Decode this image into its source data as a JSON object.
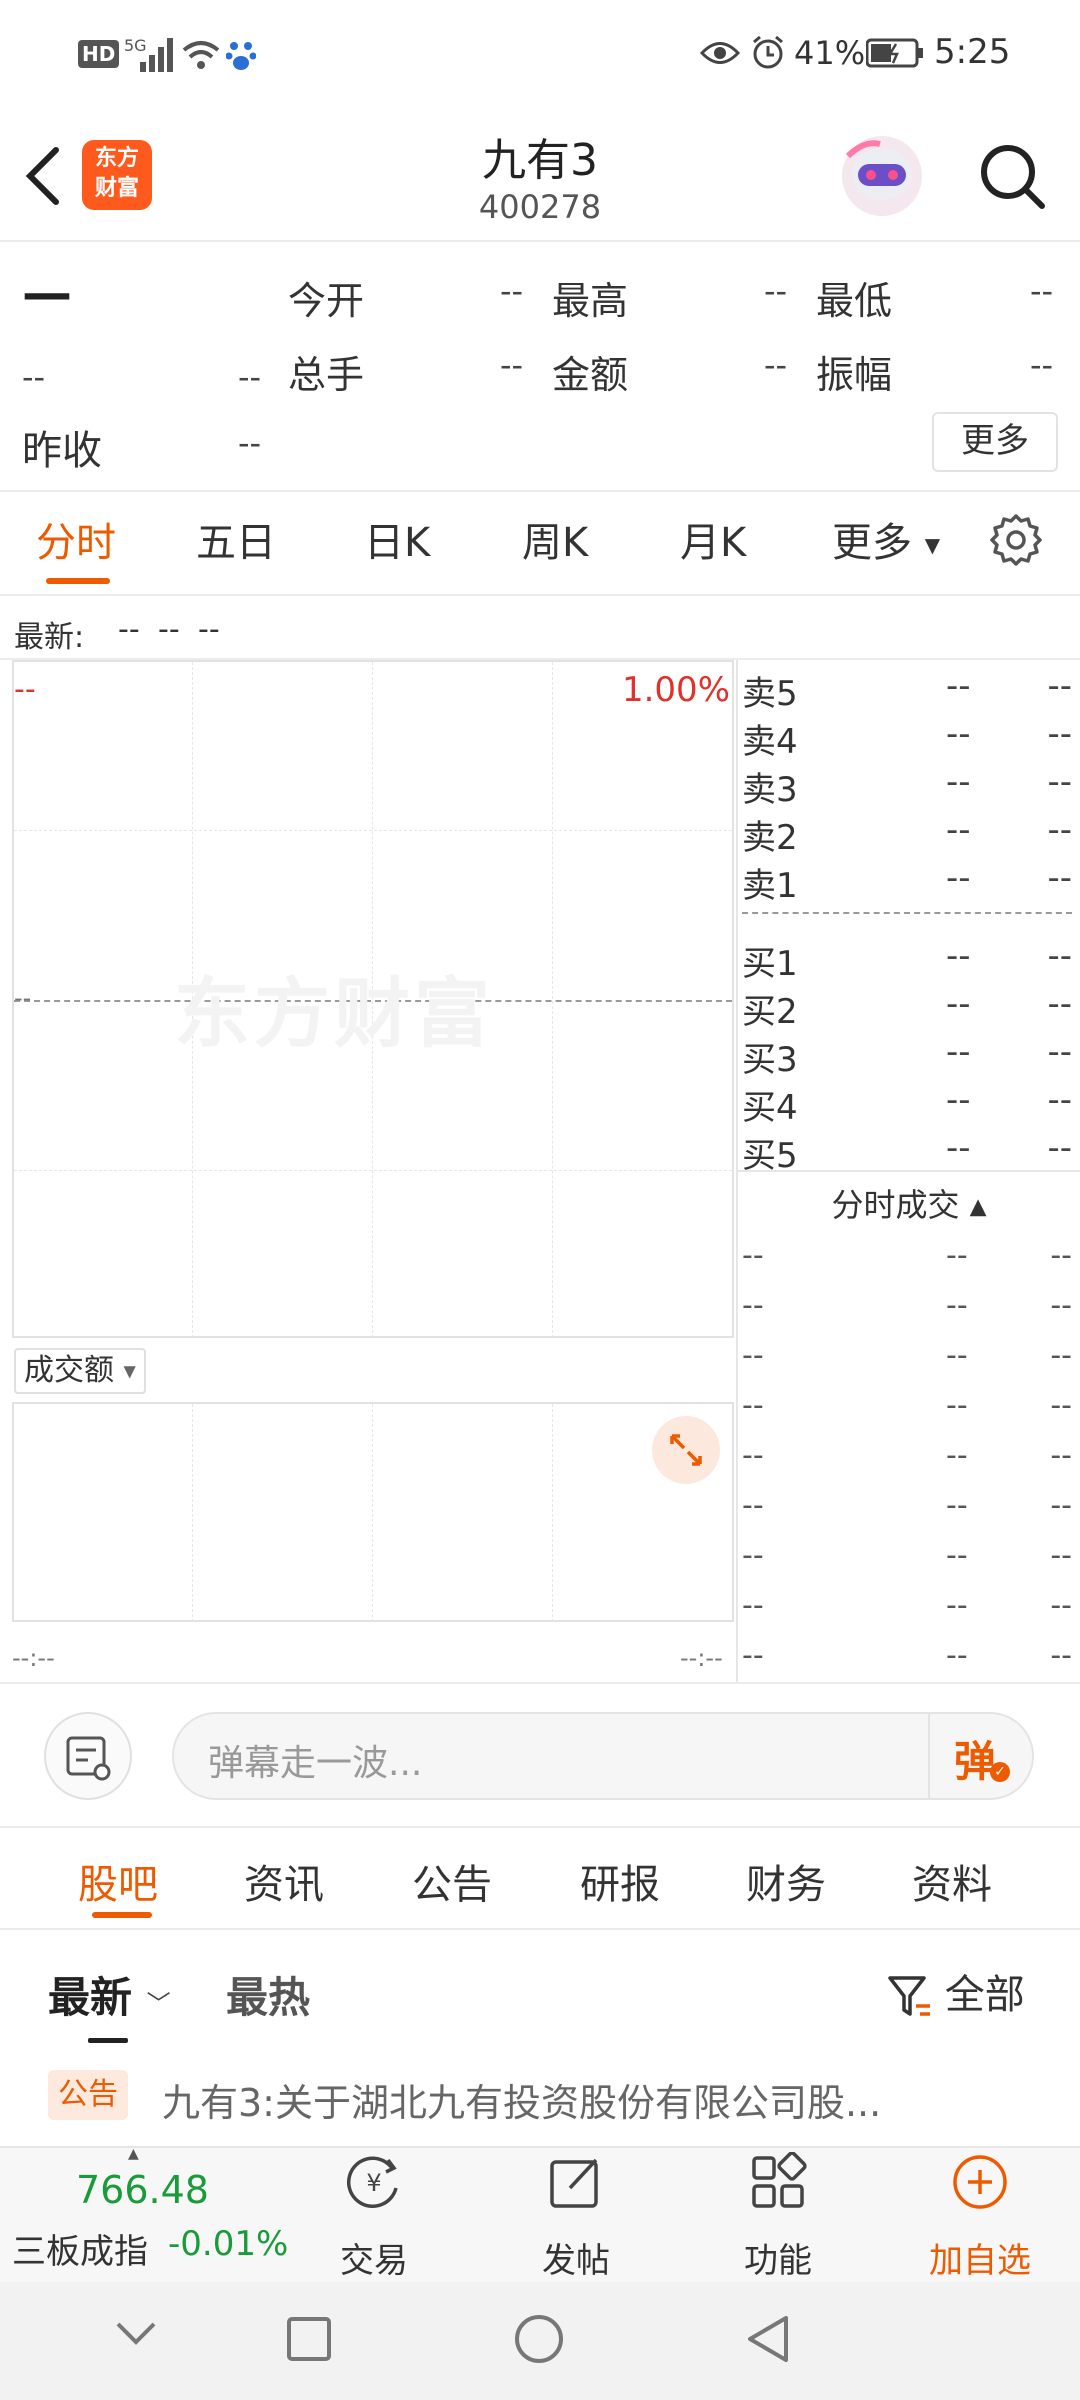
{
  "status_bar": {
    "network_badge": "HD",
    "network_type": "5G",
    "battery_text": "41%",
    "time": "5:25"
  },
  "header": {
    "logo_text": "东方\n财富",
    "title": "九有3",
    "code": "400278"
  },
  "quote": {
    "price": "—",
    "change": "--",
    "change_pct": "--",
    "stats": [
      {
        "label": "今开",
        "value": "--"
      },
      {
        "label": "最高",
        "value": "--"
      },
      {
        "label": "最低",
        "value": "--"
      },
      {
        "label": "总手",
        "value": "--"
      },
      {
        "label": "金额",
        "value": "--"
      },
      {
        "label": "振幅",
        "value": "--"
      }
    ],
    "prev_close_label": "昨收",
    "prev_close_value": "--",
    "more_button": "更多"
  },
  "chart_tabs": [
    "分时",
    "五日",
    "日K",
    "周K",
    "月K",
    "更多"
  ],
  "latest_bar": {
    "label": "最新:",
    "v1": "--",
    "v2": "--",
    "v3": "--"
  },
  "chart": {
    "left_top": "--",
    "right_top": "1.00%",
    "mid_left": "--",
    "watermark": "东方财富",
    "volume_selector": "成交额",
    "time_left": "--:--",
    "time_right": "--:--"
  },
  "order_book": {
    "sell": [
      {
        "label": "卖5",
        "price": "--",
        "vol": "--"
      },
      {
        "label": "卖4",
        "price": "--",
        "vol": "--"
      },
      {
        "label": "卖3",
        "price": "--",
        "vol": "--"
      },
      {
        "label": "卖2",
        "price": "--",
        "vol": "--"
      },
      {
        "label": "卖1",
        "price": "--",
        "vol": "--"
      }
    ],
    "buy": [
      {
        "label": "买1",
        "price": "--",
        "vol": "--"
      },
      {
        "label": "买2",
        "price": "--",
        "vol": "--"
      },
      {
        "label": "买3",
        "price": "--",
        "vol": "--"
      },
      {
        "label": "买4",
        "price": "--",
        "vol": "--"
      },
      {
        "label": "买5",
        "price": "--",
        "vol": "--"
      }
    ],
    "trades_title": "分时成交",
    "trades": [
      {
        "time": "--",
        "price": "--",
        "vol": "--"
      },
      {
        "time": "--",
        "price": "--",
        "vol": "--"
      },
      {
        "time": "--",
        "price": "--",
        "vol": "--"
      },
      {
        "time": "--",
        "price": "--",
        "vol": "--"
      },
      {
        "time": "--",
        "price": "--",
        "vol": "--"
      },
      {
        "time": "--",
        "price": "--",
        "vol": "--"
      },
      {
        "time": "--",
        "price": "--",
        "vol": "--"
      },
      {
        "time": "--",
        "price": "--",
        "vol": "--"
      },
      {
        "time": "--",
        "price": "--",
        "vol": "--"
      }
    ]
  },
  "danmaku": {
    "placeholder": "弹幕走一波...",
    "send_label": "弹"
  },
  "news_tabs": [
    "股吧",
    "资讯",
    "公告",
    "研报",
    "财务",
    "资料"
  ],
  "filters": {
    "latest": "最新",
    "hottest": "最热",
    "all": "全部"
  },
  "post": {
    "badge": "公告",
    "title": "九有3:关于湖北九有投资股份有限公司股..."
  },
  "bottom_nav": {
    "index_value": "766.48",
    "index_name": "三板成指",
    "index_change": "-0.01%",
    "items": [
      {
        "label": "交易",
        "icon": "trade-icon"
      },
      {
        "label": "发帖",
        "icon": "post-icon"
      },
      {
        "label": "功能",
        "icon": "apps-icon"
      },
      {
        "label": "加自选",
        "icon": "add-watchlist-icon"
      }
    ]
  },
  "colors": {
    "accent": "#ee5a00",
    "up": "#e0322a",
    "down": "#1a9b3a"
  }
}
